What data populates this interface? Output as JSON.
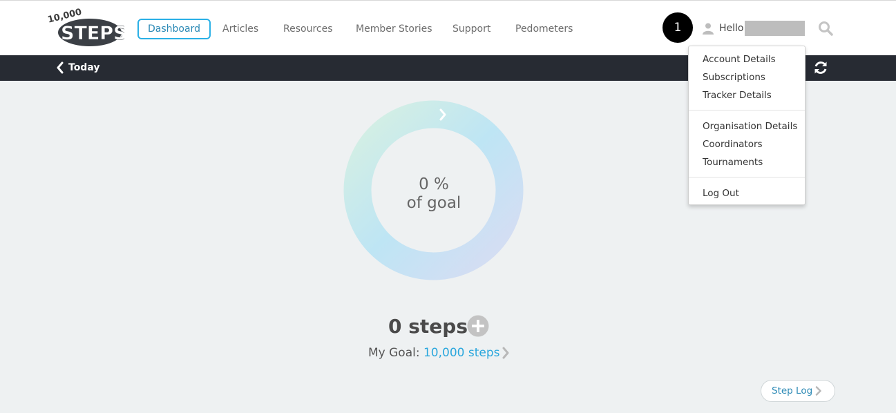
{
  "header": {
    "logo_text": "10,000 STEPS",
    "nav": [
      {
        "label": "Dashboard",
        "active": true
      },
      {
        "label": "Articles"
      },
      {
        "label": "Resources"
      },
      {
        "label": "Member Stories"
      },
      {
        "label": "Support"
      },
      {
        "label": "Pedometers"
      }
    ],
    "badge": "1",
    "greeting": "Hello",
    "user_icon": "user-icon",
    "search_icon": "search-icon"
  },
  "subbar": {
    "back_icon": "chevron-left-icon",
    "day_label": "Today",
    "refresh_icon": "refresh-icon"
  },
  "dropdown": {
    "groups": [
      [
        "Account Details",
        "Subscriptions",
        "Tracker Details"
      ],
      [
        "Organisation Details",
        "Coordinators",
        "Tournaments"
      ],
      [
        "Log Out"
      ]
    ]
  },
  "progress": {
    "percent_label": "0 %",
    "goal_label": "of goal",
    "fraction": 0
  },
  "steps": {
    "count_label": "0 steps",
    "add_icon": "plus-circle-icon",
    "goal_prefix": "My Goal:",
    "goal_value": "10,000 steps"
  },
  "step_log": {
    "label": "Step Log"
  },
  "colors": {
    "accent": "#2ab0e6",
    "subbar": "#272b33",
    "background": "#eef1f2"
  }
}
